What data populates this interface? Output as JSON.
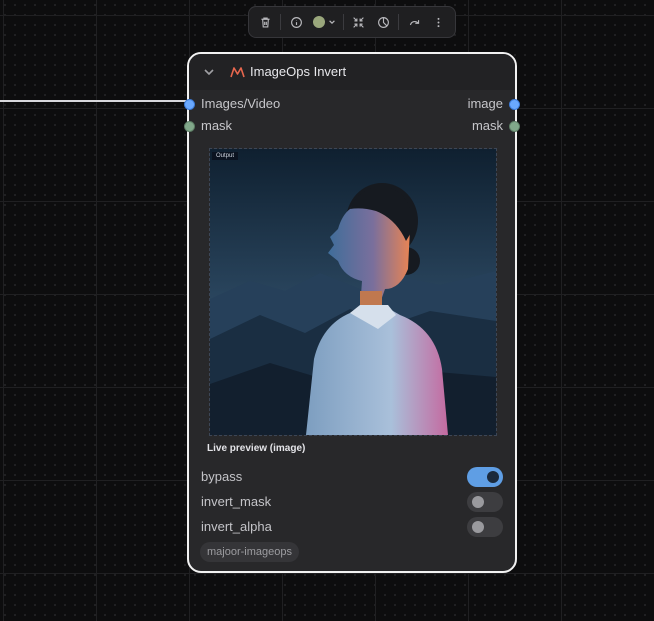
{
  "toolbar": {
    "buttons": [
      "trash-icon",
      "info-icon",
      "color-picker",
      "fit-icon",
      "bypass-icon",
      "redo-icon",
      "more-icon"
    ],
    "node_color": "#9aa77c"
  },
  "node": {
    "title": "ImageOps Invert",
    "logo_color": "#e8674e",
    "inputs": [
      {
        "label": "Images/Video",
        "color": "#6aa9ff"
      },
      {
        "label": "mask",
        "color": "#81a88a"
      }
    ],
    "outputs": [
      {
        "label": "image",
        "color": "#6aa9ff"
      },
      {
        "label": "mask",
        "color": "#81a88a"
      }
    ],
    "preview": {
      "tag": "Output",
      "caption": "Live preview (image)"
    },
    "widgets": [
      {
        "label": "bypass",
        "on": true
      },
      {
        "label": "invert_mask",
        "on": false
      },
      {
        "label": "invert_alpha",
        "on": false
      }
    ],
    "badge": "majoor-imageops"
  }
}
